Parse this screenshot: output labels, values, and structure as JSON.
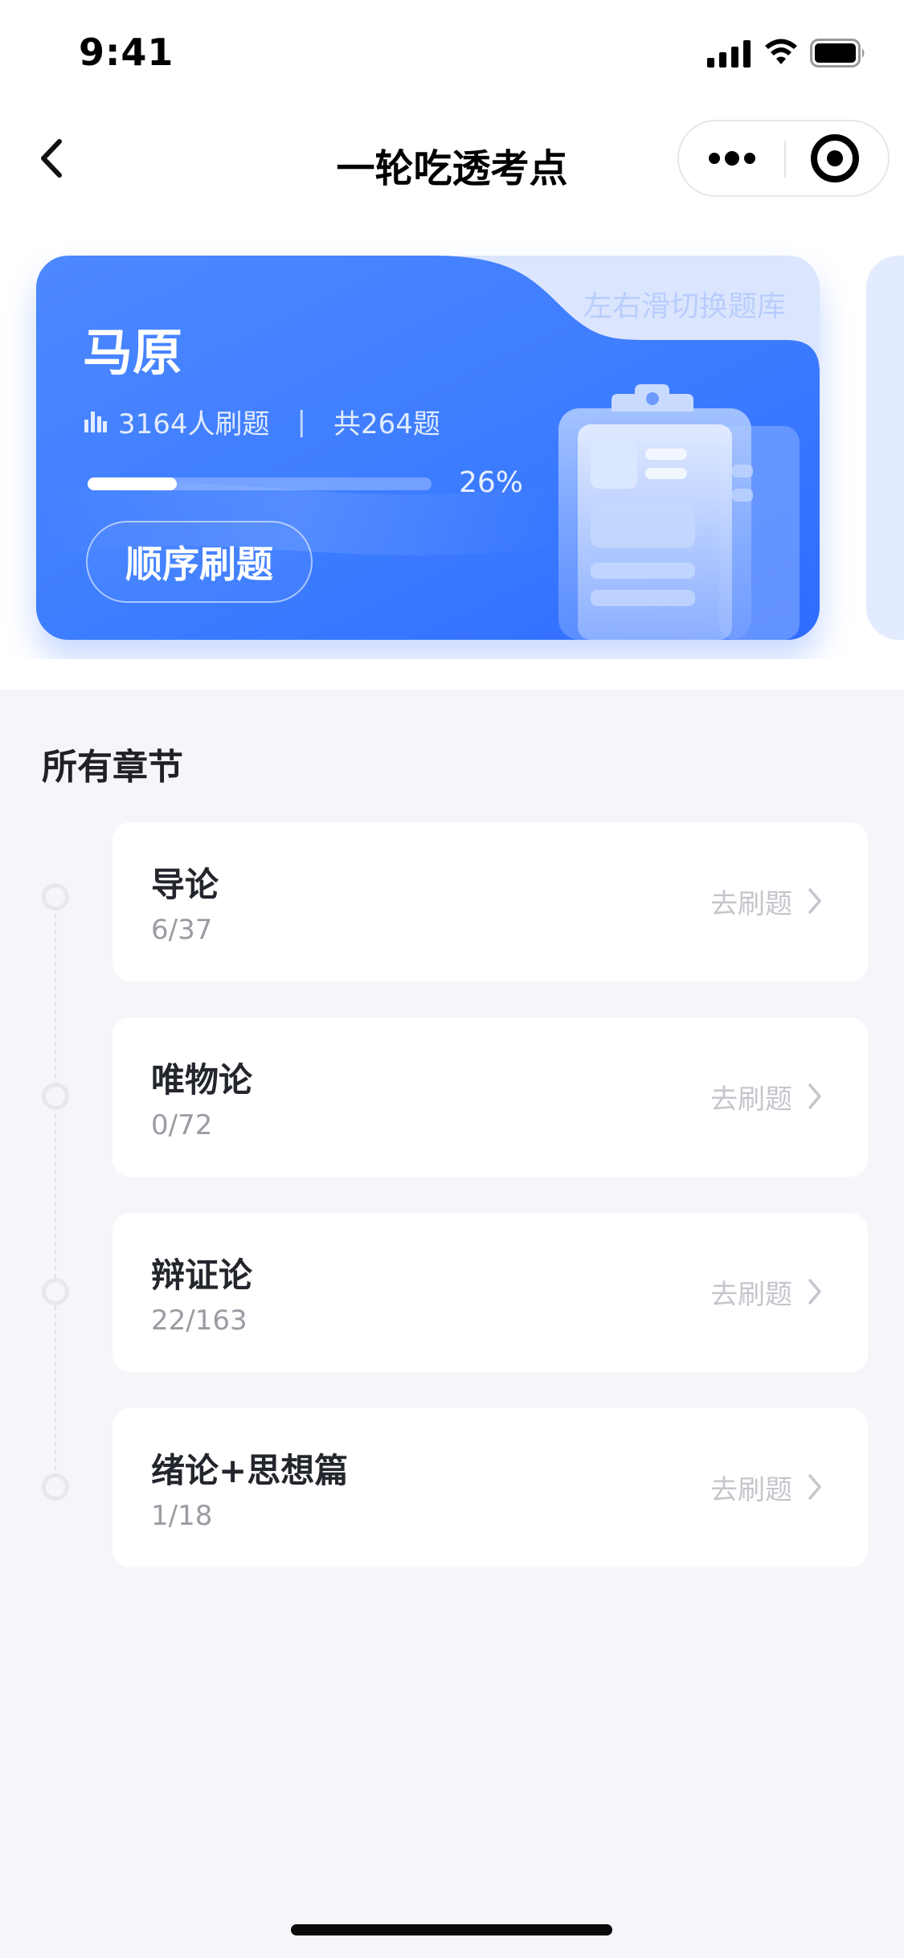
{
  "status_bar": {
    "time": "9:41"
  },
  "nav": {
    "title": "一轮吃透考点"
  },
  "card": {
    "swipe_hint": "左右滑切换题库",
    "subject": "马原",
    "users_text": "3164人刷题",
    "separator": "|",
    "total_text": "共264题",
    "progress_value": 0.26,
    "progress_label": "26%",
    "button_label": "顺序刷题"
  },
  "chapters": {
    "title": "所有章节",
    "items": [
      {
        "name": "导论",
        "progress": "6/37",
        "action": "去刷题"
      },
      {
        "name": "唯物论",
        "progress": "0/72",
        "action": "去刷题"
      },
      {
        "name": "辩证论",
        "progress": "22/163",
        "action": "去刷题"
      },
      {
        "name": "绪论+思想篇",
        "progress": "1/18",
        "action": "去刷题"
      }
    ]
  },
  "colors": {
    "accent_blue": "#3d7bff",
    "card_light": "#dbe6fe",
    "page_bg": "#f5f6fa"
  }
}
